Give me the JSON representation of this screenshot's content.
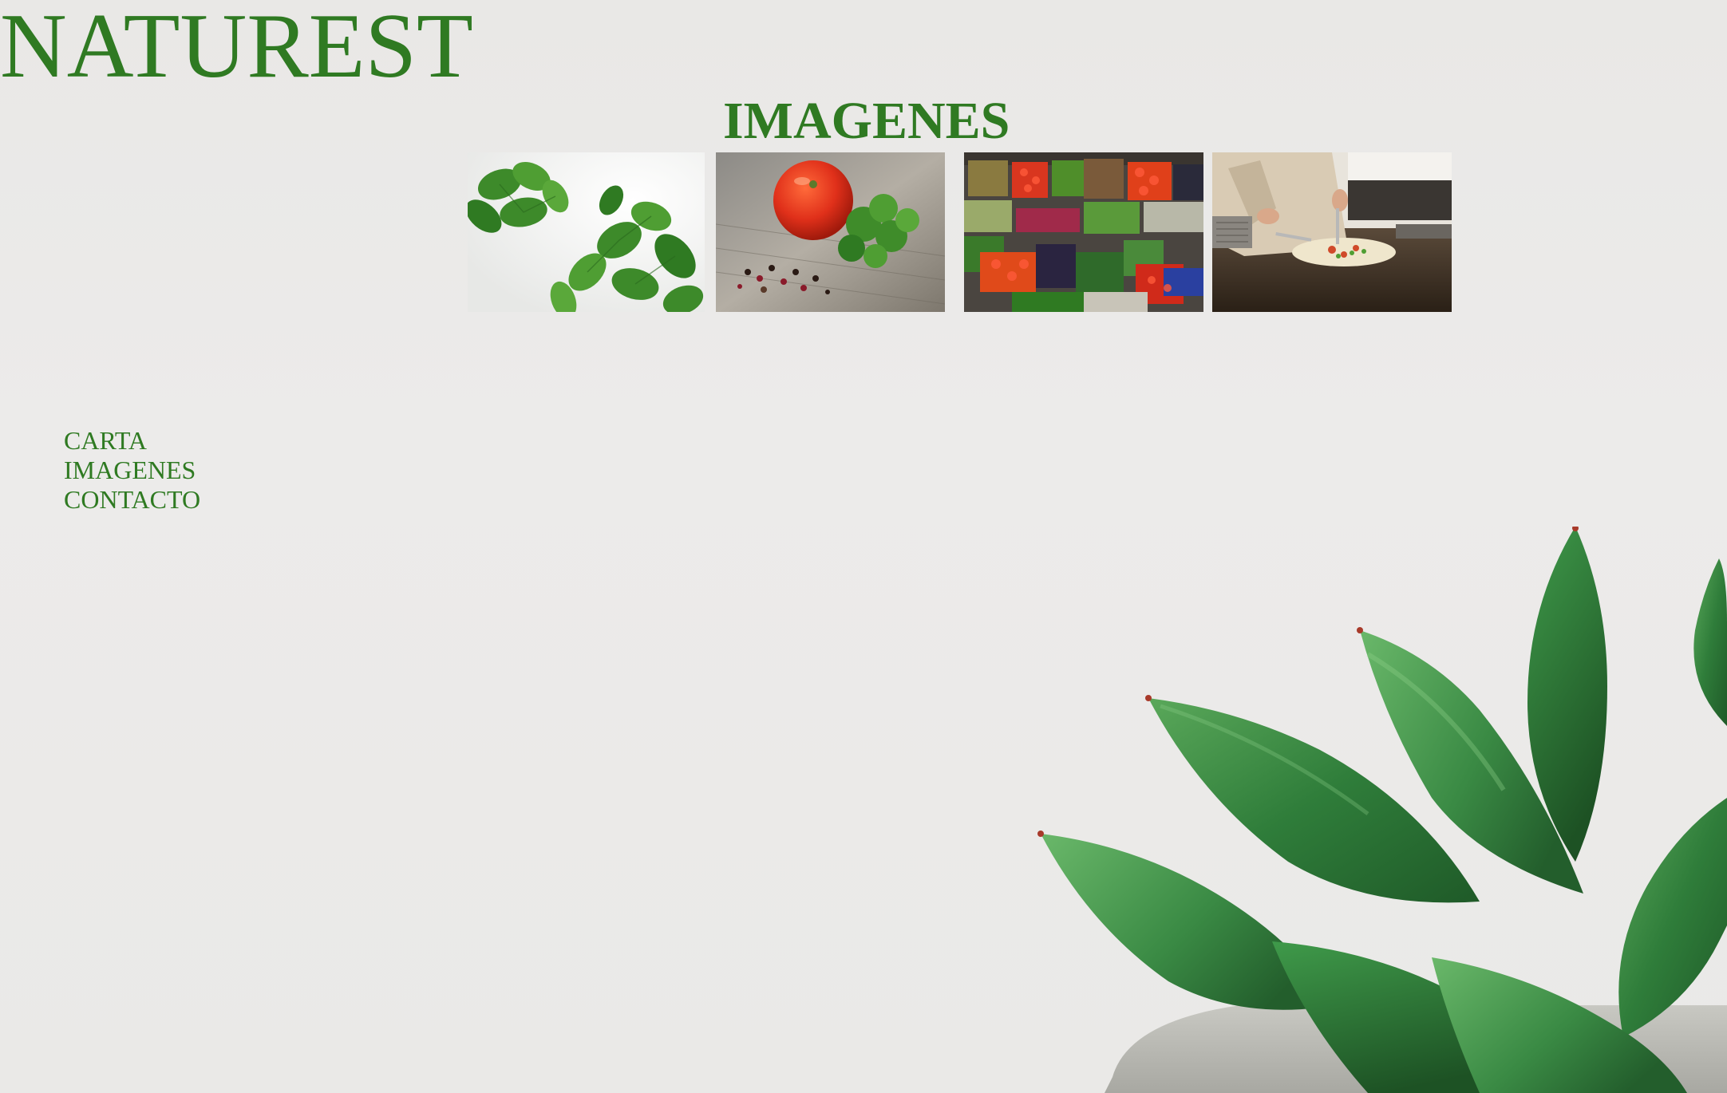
{
  "brand": {
    "title": "NATUREST"
  },
  "page": {
    "heading": "IMAGENES"
  },
  "gallery": {
    "images": [
      {
        "name": "basil-photo"
      },
      {
        "name": "tomato-parsley-photo"
      },
      {
        "name": "vegetable-market-photo"
      },
      {
        "name": "chef-cooking-photo"
      }
    ]
  },
  "nav": {
    "items": [
      {
        "label": "CARTA"
      },
      {
        "label": "IMAGENES"
      },
      {
        "label": "CONTACTO"
      }
    ]
  },
  "colors": {
    "brand_green": "#2f7a22",
    "background": "#ebeae8"
  },
  "decoration": {
    "background_image": "succulent-plant"
  }
}
